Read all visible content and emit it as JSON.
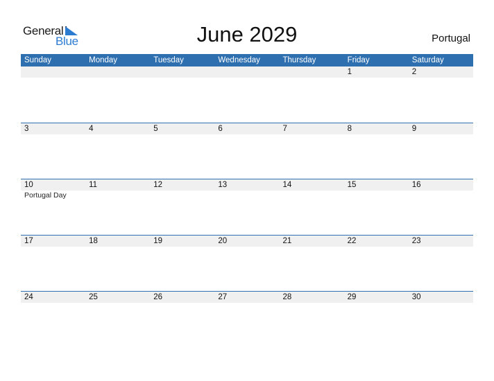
{
  "logo": {
    "line1": "General",
    "line2": "Blue"
  },
  "title": "June 2029",
  "country": "Portugal",
  "colors": {
    "header_bg": "#2e6fb0",
    "accent": "#2b7bd1",
    "strip_bg": "#f0f0f0"
  },
  "days_of_week": [
    "Sunday",
    "Monday",
    "Tuesday",
    "Wednesday",
    "Thursday",
    "Friday",
    "Saturday"
  ],
  "weeks": [
    {
      "days": [
        {
          "num": "",
          "event": ""
        },
        {
          "num": "",
          "event": ""
        },
        {
          "num": "",
          "event": ""
        },
        {
          "num": "",
          "event": ""
        },
        {
          "num": "",
          "event": ""
        },
        {
          "num": "1",
          "event": ""
        },
        {
          "num": "2",
          "event": ""
        }
      ]
    },
    {
      "days": [
        {
          "num": "3",
          "event": ""
        },
        {
          "num": "4",
          "event": ""
        },
        {
          "num": "5",
          "event": ""
        },
        {
          "num": "6",
          "event": ""
        },
        {
          "num": "7",
          "event": ""
        },
        {
          "num": "8",
          "event": ""
        },
        {
          "num": "9",
          "event": ""
        }
      ]
    },
    {
      "days": [
        {
          "num": "10",
          "event": "Portugal Day"
        },
        {
          "num": "11",
          "event": ""
        },
        {
          "num": "12",
          "event": ""
        },
        {
          "num": "13",
          "event": ""
        },
        {
          "num": "14",
          "event": ""
        },
        {
          "num": "15",
          "event": ""
        },
        {
          "num": "16",
          "event": ""
        }
      ]
    },
    {
      "days": [
        {
          "num": "17",
          "event": ""
        },
        {
          "num": "18",
          "event": ""
        },
        {
          "num": "19",
          "event": ""
        },
        {
          "num": "20",
          "event": ""
        },
        {
          "num": "21",
          "event": ""
        },
        {
          "num": "22",
          "event": ""
        },
        {
          "num": "23",
          "event": ""
        }
      ]
    },
    {
      "days": [
        {
          "num": "24",
          "event": ""
        },
        {
          "num": "25",
          "event": ""
        },
        {
          "num": "26",
          "event": ""
        },
        {
          "num": "27",
          "event": ""
        },
        {
          "num": "28",
          "event": ""
        },
        {
          "num": "29",
          "event": ""
        },
        {
          "num": "30",
          "event": ""
        }
      ]
    }
  ]
}
